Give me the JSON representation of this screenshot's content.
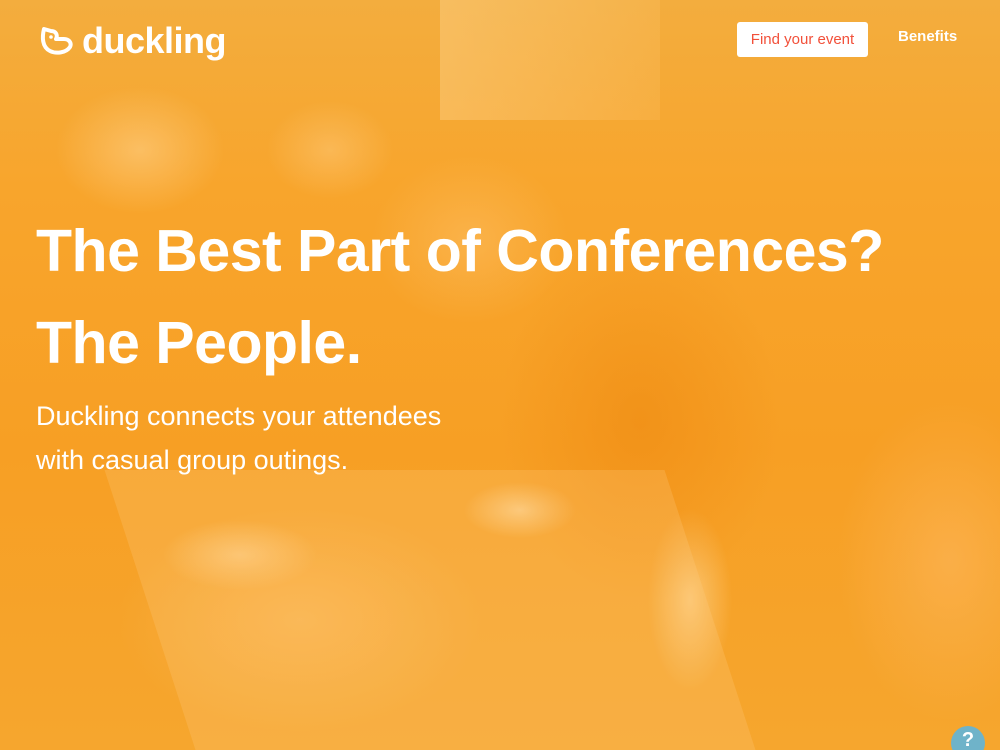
{
  "brand": {
    "name": "duckling"
  },
  "nav": {
    "find_event_label": "Find your event",
    "benefits_label": "Benefits"
  },
  "hero": {
    "headline_line1": "The Best Part of Conferences?",
    "headline_line2": "The People.",
    "subhead_line1": "Duckling connects your attendees",
    "subhead_line2": "with casual group outings."
  },
  "help": {
    "label": "?",
    "icon": "help-icon"
  },
  "colors": {
    "overlay_orange": "#f7a62a",
    "button_text": "#f2503a",
    "help_badge": "#6fb3c9"
  }
}
